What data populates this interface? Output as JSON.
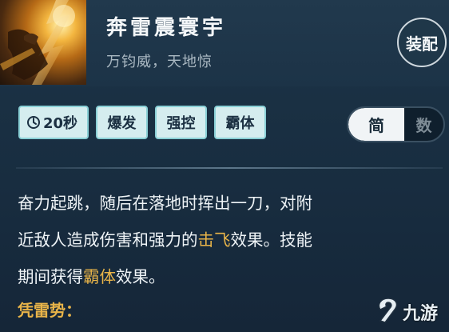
{
  "skill": {
    "name": "奔雷震寰宇",
    "subtitle": "万钧威，天地惊",
    "equip_label": "装配"
  },
  "tags": [
    {
      "label": "20秒",
      "icon": "clock-icon"
    },
    {
      "label": "爆发"
    },
    {
      "label": "强控"
    },
    {
      "label": "霸体"
    }
  ],
  "toggle": {
    "simple_label": "简",
    "detail_label": "数",
    "selected": "简"
  },
  "description": {
    "line1": "奋力起跳，随后在落地时挥出一刀，对附",
    "line2_a": "近敌人造成伤害和强力的",
    "line2_hl": "击飞",
    "line2_b": "效果。技能",
    "line3_a": "期间获得",
    "line3_hl": "霸体",
    "line3_b": "效果。",
    "sub_heading": "凭雷势："
  },
  "watermark": {
    "text": "九游",
    "icon": "jiuyou-logo-icon"
  },
  "colors": {
    "highlight": "#e8b449",
    "tag_bg": "#d5edef",
    "tag_border": "#8ad0d6",
    "panel_bg": "#1c3447"
  }
}
